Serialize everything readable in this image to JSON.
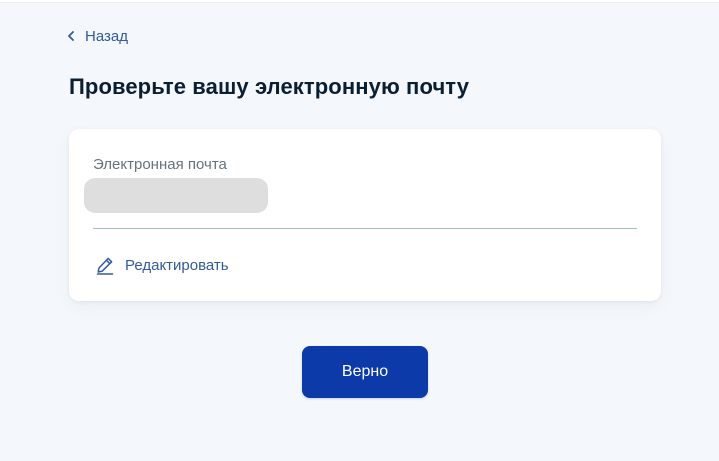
{
  "nav": {
    "back_label": "Назад",
    "back_icon": "chevron-left-icon"
  },
  "page": {
    "title": "Проверьте вашу электронную почту"
  },
  "email_card": {
    "field_label": "Электронная почта",
    "field_value": "",
    "field_value_redacted": true,
    "edit_label": "Редактировать",
    "edit_icon": "pencil-icon"
  },
  "actions": {
    "confirm_label": "Верно"
  },
  "colors": {
    "background": "#f4f7fc",
    "link": "#335a9b",
    "primary_button": "#0d3aa9",
    "title": "#0b1f33",
    "muted": "#66727f",
    "underline": "#9fc0bd",
    "redaction": "#dedede"
  }
}
